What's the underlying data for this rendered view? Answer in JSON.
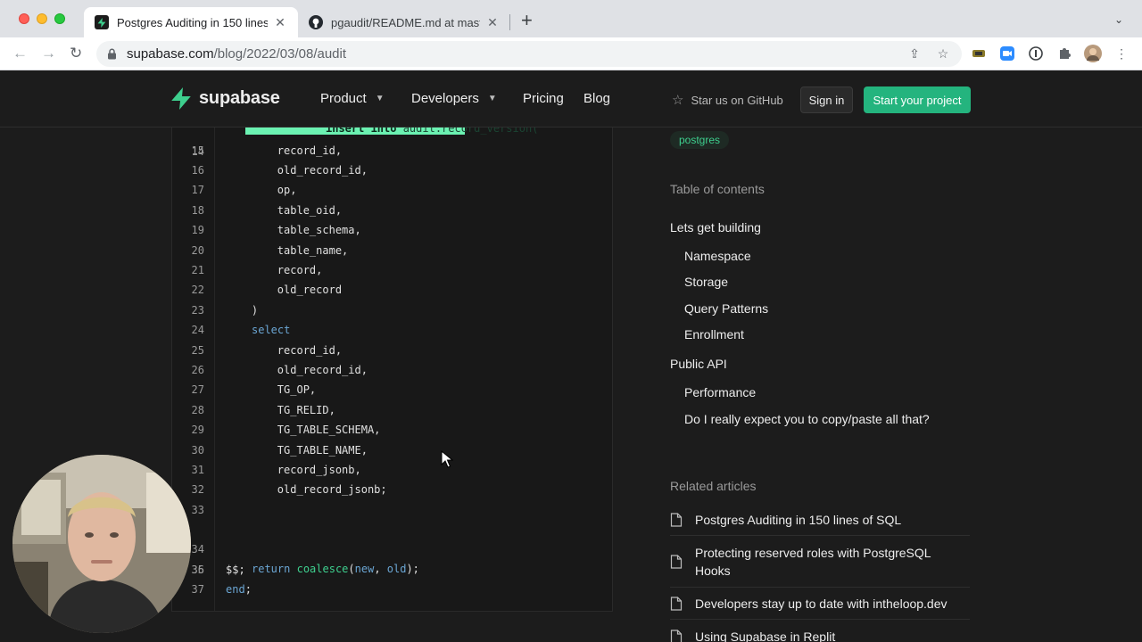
{
  "browser": {
    "tabs": [
      {
        "title": "Postgres Auditing in 150 lines of SQL",
        "active": true
      },
      {
        "title": "pgaudit/README.md at master",
        "active": false
      }
    ],
    "url": {
      "domain": "supabase.com",
      "path": "/blog/2022/03/08/audit"
    }
  },
  "site": {
    "brand": "supabase",
    "nav": {
      "product": "Product",
      "developers": "Developers",
      "pricing": "Pricing",
      "blog": "Blog",
      "star": "Star us on GitHub",
      "signin": "Sign in",
      "start": "Start your project"
    }
  },
  "code": {
    "highlight": {
      "kw": "insert into",
      "rest": " audit.record_version("
    },
    "lines": [
      {
        "n": "14",
        "text": ""
      },
      {
        "n": "15",
        "text": "        record_id,"
      },
      {
        "n": "16",
        "text": "        old_record_id,"
      },
      {
        "n": "17",
        "text": "        op,"
      },
      {
        "n": "18",
        "text": "        table_oid,"
      },
      {
        "n": "19",
        "text": "        table_schema,"
      },
      {
        "n": "20",
        "text": "        table_name,"
      },
      {
        "n": "21",
        "text": "        record,"
      },
      {
        "n": "22",
        "text": "        old_record"
      },
      {
        "n": "23",
        "text": "    )"
      },
      {
        "n": "24",
        "text": "select"
      },
      {
        "n": "25",
        "text": "        record_id,"
      },
      {
        "n": "26",
        "text": "        old_record_id,"
      },
      {
        "n": "27",
        "text": "        TG_OP,"
      },
      {
        "n": "28",
        "text": "        TG_RELID,"
      },
      {
        "n": "29",
        "text": "        TG_TABLE_SCHEMA,"
      },
      {
        "n": "30",
        "text": "        TG_TABLE_NAME,"
      },
      {
        "n": "31",
        "text": "        record_jsonb,"
      },
      {
        "n": "32",
        "text": "        old_record_jsonb;"
      },
      {
        "n": "33",
        "text": ""
      },
      {
        "n": "34",
        "text": ""
      },
      {
        "n": "35",
        "text": ""
      },
      {
        "n": "36",
        "text": "$$;"
      },
      {
        "n": "37",
        "text": ""
      }
    ],
    "select_kw": "select",
    "return_line": {
      "kw": "return",
      "fn": "coalesce",
      "open": "(",
      "a": "new",
      "sep": ", ",
      "b": "old",
      "close": ");"
    },
    "end_kw": "end",
    "end_semi": ";"
  },
  "sidebar": {
    "tag": "postgres",
    "toc_heading": "Table of contents",
    "toc": [
      "Lets get building",
      "Namespace",
      "Storage",
      "Query Patterns",
      "Enrollment",
      "Public API",
      "Performance",
      "Do I really expect you to copy/paste all that?"
    ],
    "related_heading": "Related articles",
    "related": [
      "Postgres Auditing in 150 lines of SQL",
      "Protecting reserved roles with PostgreSQL Hooks",
      "Developers stay up to date with intheloop.dev",
      "Using Supabase in Replit"
    ]
  },
  "colors": {
    "brand": "#3ecf8e",
    "button": "#24b47e",
    "highlight": "#6bf2b2"
  }
}
